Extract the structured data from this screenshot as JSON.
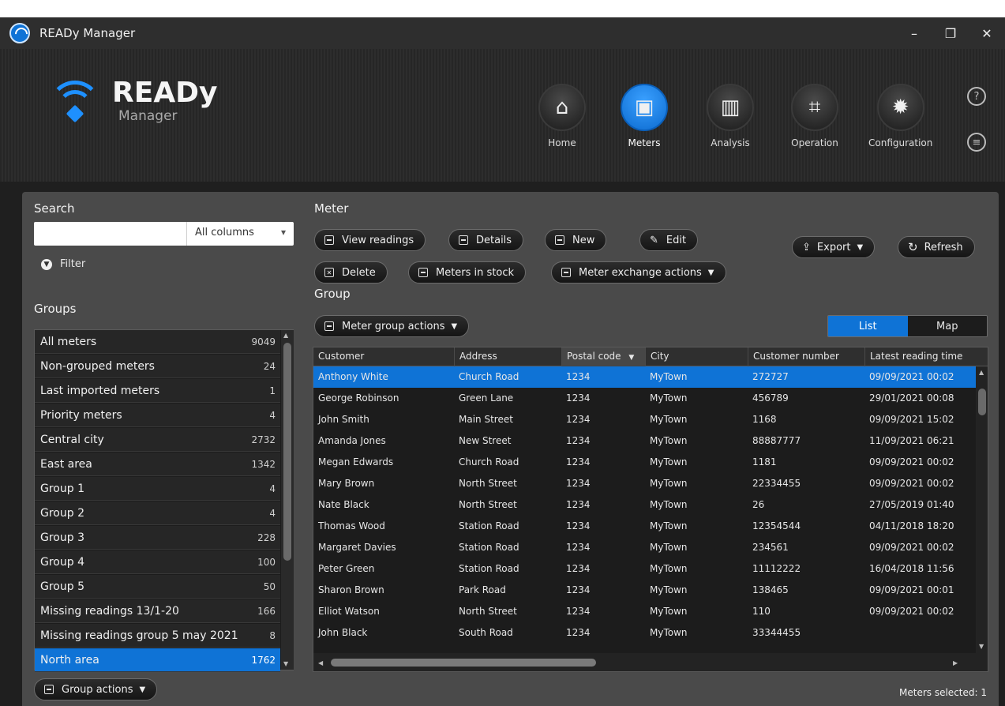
{
  "window": {
    "title": "READy Manager",
    "buttons": {
      "minimize": "–",
      "restore": "❐",
      "close": "✕"
    }
  },
  "logo": {
    "line1": "READy",
    "line2": "Manager"
  },
  "nav": [
    {
      "label": "Home",
      "icon": "home-icon",
      "glyph": "⌂"
    },
    {
      "label": "Meters",
      "icon": "meter-icon",
      "glyph": "▣"
    },
    {
      "label": "Analysis",
      "icon": "bar-chart-icon",
      "glyph": "▥"
    },
    {
      "label": "Operation",
      "icon": "operation-icon",
      "glyph": "⌗"
    },
    {
      "label": "Configuration",
      "icon": "gear-icon",
      "glyph": "✹"
    }
  ],
  "help": {
    "help_glyph": "?",
    "notes_glyph": "≡"
  },
  "search": {
    "heading": "Search",
    "value": "",
    "column_select": "All columns",
    "filter_label": "Filter"
  },
  "groups": {
    "heading": "Groups",
    "items": [
      {
        "name": "All meters",
        "count": "9049"
      },
      {
        "name": "Non-grouped meters",
        "count": "24"
      },
      {
        "name": "Last imported meters",
        "count": "1"
      },
      {
        "name": "Priority meters",
        "count": "4"
      },
      {
        "name": "Central city",
        "count": "2732"
      },
      {
        "name": "East area",
        "count": "1342"
      },
      {
        "name": "Group 1",
        "count": "4"
      },
      {
        "name": "Group 2",
        "count": "4"
      },
      {
        "name": "Group 3",
        "count": "228"
      },
      {
        "name": "Group 4",
        "count": "100"
      },
      {
        "name": "Group 5",
        "count": "50"
      },
      {
        "name": "Missing readings 13/1-20",
        "count": "166"
      },
      {
        "name": "Missing readings group 5 may 2021",
        "count": "8"
      },
      {
        "name": "North area",
        "count": "1762"
      }
    ],
    "actions_label": "Group actions"
  },
  "meter": {
    "heading": "Meter",
    "buttons": {
      "view_readings": "View readings",
      "details": "Details",
      "new": "New",
      "edit": "Edit",
      "delete": "Delete",
      "meters_in_stock": "Meters in stock",
      "exchange": "Meter exchange actions",
      "export": "Export",
      "refresh": "Refresh"
    }
  },
  "group": {
    "heading": "Group",
    "actions_label": "Meter group actions",
    "view_toggle": {
      "list": "List",
      "map": "Map",
      "selected": "List"
    }
  },
  "table": {
    "columns": [
      "Customer",
      "Address",
      "Postal code",
      "City",
      "Customer number",
      "Latest reading time"
    ],
    "sorted_column": "Postal code",
    "rows": [
      [
        "Anthony White",
        "Church Road",
        "1234",
        "MyTown",
        "272727",
        "09/09/2021 00:02"
      ],
      [
        "George Robinson",
        "Green Lane",
        "1234",
        "MyTown",
        "456789",
        "29/01/2021 00:08"
      ],
      [
        "John Smith",
        "Main Street",
        "1234",
        "MyTown",
        "1168",
        "09/09/2021 15:02"
      ],
      [
        "Amanda Jones",
        "New Street",
        "1234",
        "MyTown",
        "88887777",
        "11/09/2021 06:21"
      ],
      [
        "Megan Edwards",
        "Church Road",
        "1234",
        "MyTown",
        "1181",
        "09/09/2021 00:02"
      ],
      [
        "Mary Brown",
        "North Street",
        "1234",
        "MyTown",
        "22334455",
        "09/09/2021 00:02"
      ],
      [
        "Nate Black",
        "North Street",
        "1234",
        "MyTown",
        "26",
        "27/05/2019 01:40"
      ],
      [
        "Thomas Wood",
        "Station Road",
        "1234",
        "MyTown",
        "12354544",
        "04/11/2018 18:20"
      ],
      [
        "Margaret Davies",
        "Station Road",
        "1234",
        "MyTown",
        "234561",
        "09/09/2021 00:02"
      ],
      [
        "Peter Green",
        "Station Road",
        "1234",
        "MyTown",
        "11112222",
        "16/04/2018 11:56"
      ],
      [
        "Sharon Brown",
        "Park Road",
        "1234",
        "MyTown",
        "138465",
        "09/09/2021 00:01"
      ],
      [
        "Elliot Watson",
        "North Street",
        "1234",
        "MyTown",
        "110",
        "09/09/2021 00:02"
      ],
      [
        "John Black",
        "South Road",
        "1234",
        "MyTown",
        "33344455",
        ""
      ]
    ],
    "selected_row": 0
  },
  "status": {
    "meters_selected": "Meters selected: 1"
  },
  "colors": {
    "accent": "#0f73d6",
    "panel": "#4a4a4a",
    "list_bg": "#1c1c1c"
  }
}
